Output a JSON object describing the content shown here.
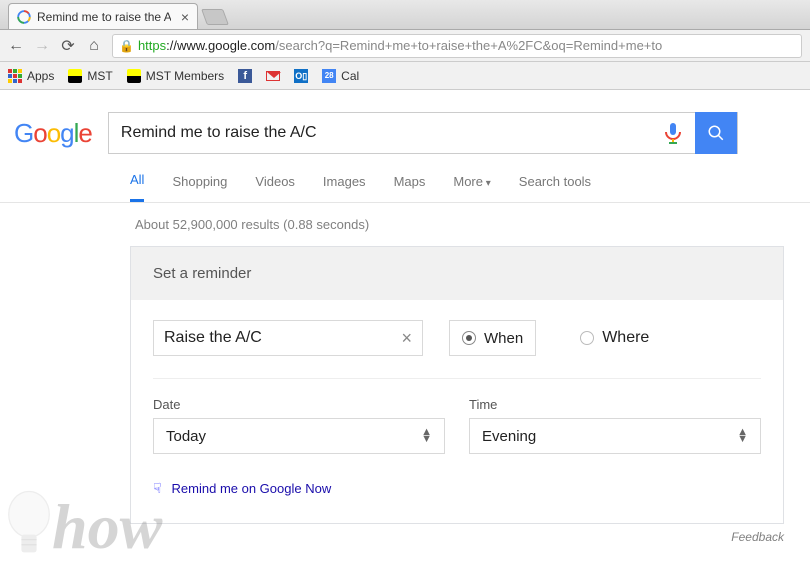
{
  "browser": {
    "tab_title": "Remind me to raise the A/",
    "url_https": "https",
    "url_host": "://www.google.com",
    "url_path": "/search?q=Remind+me+to+raise+the+A%2FC&oq=Remind+me+to",
    "bookmarks": {
      "apps": "Apps",
      "mst": "MST",
      "mst_members": "MST Members",
      "cal": "Cal",
      "cal_num": "28",
      "ol": "O▯",
      "fb": "f"
    }
  },
  "search": {
    "query": "Remind me to raise the A/C"
  },
  "nav": {
    "all": "All",
    "shopping": "Shopping",
    "videos": "Videos",
    "images": "Images",
    "maps": "Maps",
    "more": "More",
    "tools": "Search tools"
  },
  "stats": "About 52,900,000 results (0.88 seconds)",
  "reminder": {
    "header": "Set a reminder",
    "text": "Raise the A/C",
    "when": "When",
    "where": "Where",
    "date_label": "Date",
    "date_value": "Today",
    "time_label": "Time",
    "time_value": "Evening",
    "now_link": "Remind me on Google Now"
  },
  "feedback": "Feedback",
  "watermark": "how"
}
